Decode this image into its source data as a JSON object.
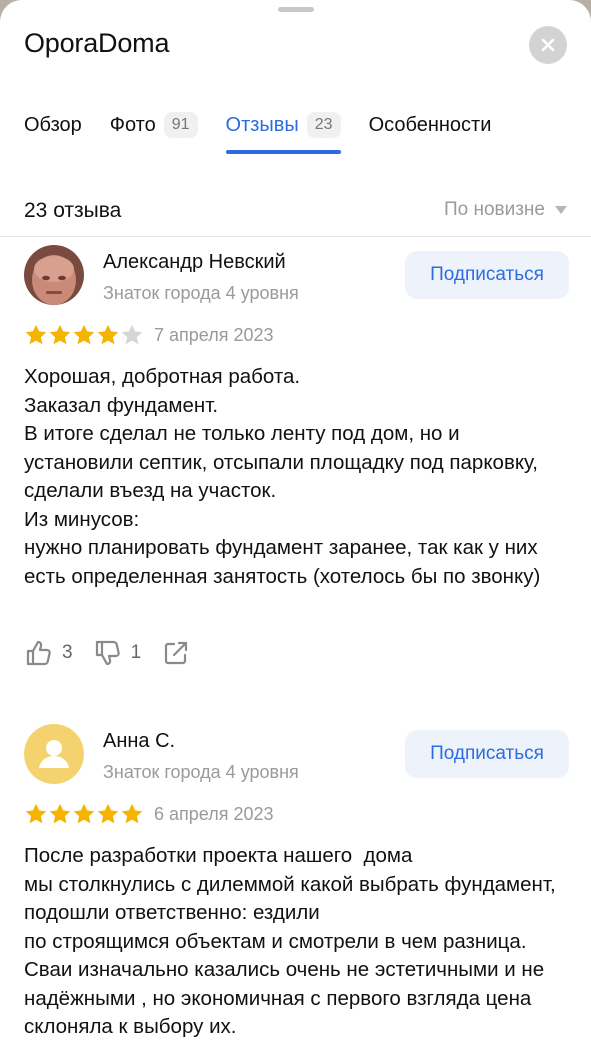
{
  "header": {
    "title": "OporaDoma"
  },
  "tabs": [
    {
      "label": "Обзор",
      "count": ""
    },
    {
      "label": "Фото",
      "count": "91"
    },
    {
      "label": "Отзывы",
      "count": "23"
    },
    {
      "label": "Особенности",
      "count": ""
    }
  ],
  "reviews_header": {
    "count_label": "23 отзыва",
    "sort_label": "По новизне"
  },
  "reviews": [
    {
      "author": "Александр Невский",
      "level": "Знаток города 4 уровня",
      "subscribe_label": "Подписаться",
      "rating": 4,
      "date": "7 апреля 2023",
      "text": "Хорошая, добротная работа.\nЗаказал фундамент.\nВ итоге сделал не только ленту под дом, но и установили септик, отсыпали площадку под парковку, сделали въезд на участок.\nИз минусов:\nнужно планировать фундамент заранее, так как у них есть определенная занятость (хотелось бы по звонку)",
      "likes": "3",
      "dislikes": "1"
    },
    {
      "author": "Анна С.",
      "level": "Знаток города 4 уровня",
      "subscribe_label": "Подписаться",
      "rating": 5,
      "date": "6 апреля 2023",
      "text": "После разработки проекта нашего  дома\nмы столкнулись с дилеммой какой выбрать фундамент, подошли ответственно: ездили\nпо строящимся объектам и смотрели в чем разница. Сваи изначально казались очень не эстетичными и не надёжными , но экономичная с первого взгляда цена склоняла к выбору их."
    }
  ],
  "colors": {
    "accent": "#2b6de0",
    "star": "#f5b400",
    "star_empty": "#d6d6d6",
    "avatar_yellow": "#f4d36e"
  }
}
